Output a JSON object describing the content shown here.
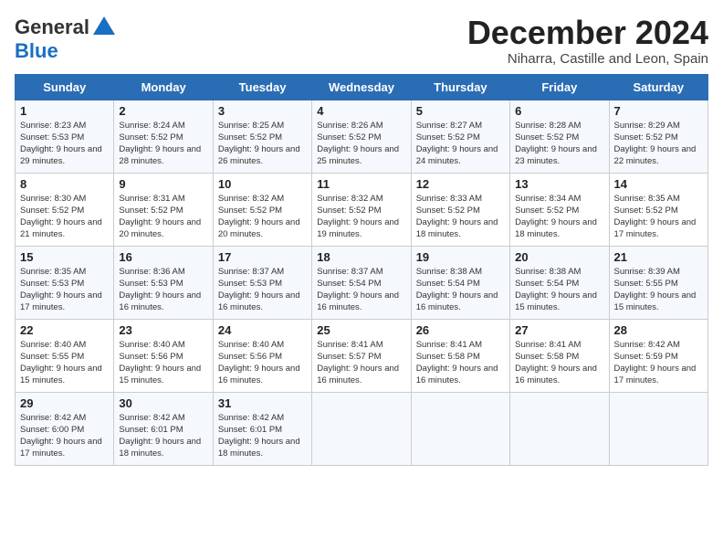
{
  "header": {
    "logo_line1": "General",
    "logo_line2": "Blue",
    "title": "December 2024",
    "subtitle": "Niharra, Castille and Leon, Spain"
  },
  "weekdays": [
    "Sunday",
    "Monday",
    "Tuesday",
    "Wednesday",
    "Thursday",
    "Friday",
    "Saturday"
  ],
  "weeks": [
    [
      {
        "day": "1",
        "sunrise": "Sunrise: 8:23 AM",
        "sunset": "Sunset: 5:53 PM",
        "daylight": "Daylight: 9 hours and 29 minutes."
      },
      {
        "day": "2",
        "sunrise": "Sunrise: 8:24 AM",
        "sunset": "Sunset: 5:52 PM",
        "daylight": "Daylight: 9 hours and 28 minutes."
      },
      {
        "day": "3",
        "sunrise": "Sunrise: 8:25 AM",
        "sunset": "Sunset: 5:52 PM",
        "daylight": "Daylight: 9 hours and 26 minutes."
      },
      {
        "day": "4",
        "sunrise": "Sunrise: 8:26 AM",
        "sunset": "Sunset: 5:52 PM",
        "daylight": "Daylight: 9 hours and 25 minutes."
      },
      {
        "day": "5",
        "sunrise": "Sunrise: 8:27 AM",
        "sunset": "Sunset: 5:52 PM",
        "daylight": "Daylight: 9 hours and 24 minutes."
      },
      {
        "day": "6",
        "sunrise": "Sunrise: 8:28 AM",
        "sunset": "Sunset: 5:52 PM",
        "daylight": "Daylight: 9 hours and 23 minutes."
      },
      {
        "day": "7",
        "sunrise": "Sunrise: 8:29 AM",
        "sunset": "Sunset: 5:52 PM",
        "daylight": "Daylight: 9 hours and 22 minutes."
      }
    ],
    [
      {
        "day": "8",
        "sunrise": "Sunrise: 8:30 AM",
        "sunset": "Sunset: 5:52 PM",
        "daylight": "Daylight: 9 hours and 21 minutes."
      },
      {
        "day": "9",
        "sunrise": "Sunrise: 8:31 AM",
        "sunset": "Sunset: 5:52 PM",
        "daylight": "Daylight: 9 hours and 20 minutes."
      },
      {
        "day": "10",
        "sunrise": "Sunrise: 8:32 AM",
        "sunset": "Sunset: 5:52 PM",
        "daylight": "Daylight: 9 hours and 20 minutes."
      },
      {
        "day": "11",
        "sunrise": "Sunrise: 8:32 AM",
        "sunset": "Sunset: 5:52 PM",
        "daylight": "Daylight: 9 hours and 19 minutes."
      },
      {
        "day": "12",
        "sunrise": "Sunrise: 8:33 AM",
        "sunset": "Sunset: 5:52 PM",
        "daylight": "Daylight: 9 hours and 18 minutes."
      },
      {
        "day": "13",
        "sunrise": "Sunrise: 8:34 AM",
        "sunset": "Sunset: 5:52 PM",
        "daylight": "Daylight: 9 hours and 18 minutes."
      },
      {
        "day": "14",
        "sunrise": "Sunrise: 8:35 AM",
        "sunset": "Sunset: 5:52 PM",
        "daylight": "Daylight: 9 hours and 17 minutes."
      }
    ],
    [
      {
        "day": "15",
        "sunrise": "Sunrise: 8:35 AM",
        "sunset": "Sunset: 5:53 PM",
        "daylight": "Daylight: 9 hours and 17 minutes."
      },
      {
        "day": "16",
        "sunrise": "Sunrise: 8:36 AM",
        "sunset": "Sunset: 5:53 PM",
        "daylight": "Daylight: 9 hours and 16 minutes."
      },
      {
        "day": "17",
        "sunrise": "Sunrise: 8:37 AM",
        "sunset": "Sunset: 5:53 PM",
        "daylight": "Daylight: 9 hours and 16 minutes."
      },
      {
        "day": "18",
        "sunrise": "Sunrise: 8:37 AM",
        "sunset": "Sunset: 5:54 PM",
        "daylight": "Daylight: 9 hours and 16 minutes."
      },
      {
        "day": "19",
        "sunrise": "Sunrise: 8:38 AM",
        "sunset": "Sunset: 5:54 PM",
        "daylight": "Daylight: 9 hours and 16 minutes."
      },
      {
        "day": "20",
        "sunrise": "Sunrise: 8:38 AM",
        "sunset": "Sunset: 5:54 PM",
        "daylight": "Daylight: 9 hours and 15 minutes."
      },
      {
        "day": "21",
        "sunrise": "Sunrise: 8:39 AM",
        "sunset": "Sunset: 5:55 PM",
        "daylight": "Daylight: 9 hours and 15 minutes."
      }
    ],
    [
      {
        "day": "22",
        "sunrise": "Sunrise: 8:40 AM",
        "sunset": "Sunset: 5:55 PM",
        "daylight": "Daylight: 9 hours and 15 minutes."
      },
      {
        "day": "23",
        "sunrise": "Sunrise: 8:40 AM",
        "sunset": "Sunset: 5:56 PM",
        "daylight": "Daylight: 9 hours and 15 minutes."
      },
      {
        "day": "24",
        "sunrise": "Sunrise: 8:40 AM",
        "sunset": "Sunset: 5:56 PM",
        "daylight": "Daylight: 9 hours and 16 minutes."
      },
      {
        "day": "25",
        "sunrise": "Sunrise: 8:41 AM",
        "sunset": "Sunset: 5:57 PM",
        "daylight": "Daylight: 9 hours and 16 minutes."
      },
      {
        "day": "26",
        "sunrise": "Sunrise: 8:41 AM",
        "sunset": "Sunset: 5:58 PM",
        "daylight": "Daylight: 9 hours and 16 minutes."
      },
      {
        "day": "27",
        "sunrise": "Sunrise: 8:41 AM",
        "sunset": "Sunset: 5:58 PM",
        "daylight": "Daylight: 9 hours and 16 minutes."
      },
      {
        "day": "28",
        "sunrise": "Sunrise: 8:42 AM",
        "sunset": "Sunset: 5:59 PM",
        "daylight": "Daylight: 9 hours and 17 minutes."
      }
    ],
    [
      {
        "day": "29",
        "sunrise": "Sunrise: 8:42 AM",
        "sunset": "Sunset: 6:00 PM",
        "daylight": "Daylight: 9 hours and 17 minutes."
      },
      {
        "day": "30",
        "sunrise": "Sunrise: 8:42 AM",
        "sunset": "Sunset: 6:01 PM",
        "daylight": "Daylight: 9 hours and 18 minutes."
      },
      {
        "day": "31",
        "sunrise": "Sunrise: 8:42 AM",
        "sunset": "Sunset: 6:01 PM",
        "daylight": "Daylight: 9 hours and 18 minutes."
      },
      null,
      null,
      null,
      null
    ]
  ]
}
